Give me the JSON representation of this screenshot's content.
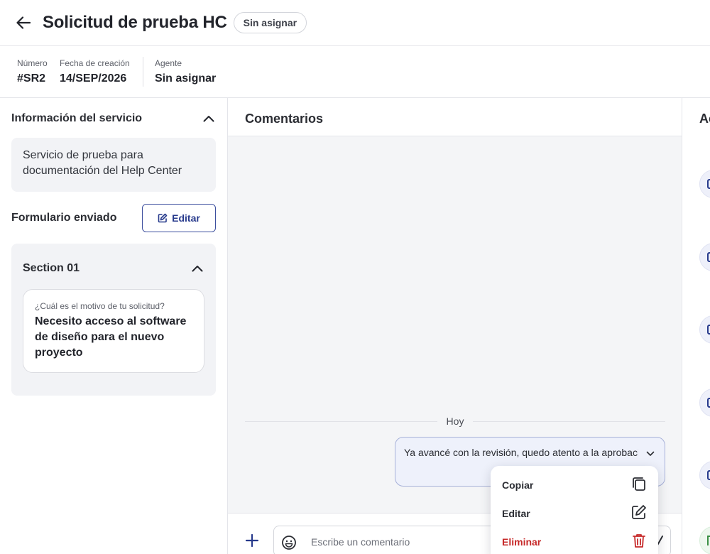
{
  "header": {
    "title": "Solicitud de prueba HC",
    "status": "Sin asignar"
  },
  "meta": {
    "number_label": "Número",
    "number_value": "#SR2",
    "date_label": "Fecha de creación",
    "date_value": "14/SEP/2026",
    "agent_label": "Agente",
    "agent_value": "Sin asignar"
  },
  "service": {
    "title": "Información del servicio",
    "description": "Servicio de prueba para documentación del Help Center"
  },
  "form": {
    "title": "Formulario enviado",
    "edit_label": "Editar",
    "section_title": "Section 01",
    "question": "¿Cuál es el motivo de tu solicitud?",
    "answer": "Necesito acceso al software de diseño para el nuevo proyecto"
  },
  "comments": {
    "title": "Comentarios",
    "day_label": "Hoy",
    "message": "Ya avancé con la revisión, quedo atento a la aprobación",
    "placeholder": "Escribe un comentario"
  },
  "menu": {
    "copy": "Copiar",
    "edit": "Editar",
    "delete": "Eliminar"
  },
  "right_panel": {
    "title": "Actividad"
  },
  "colors": {
    "primary": "#273a8c",
    "danger": "#c62828",
    "surface": "#f2f3f6"
  }
}
